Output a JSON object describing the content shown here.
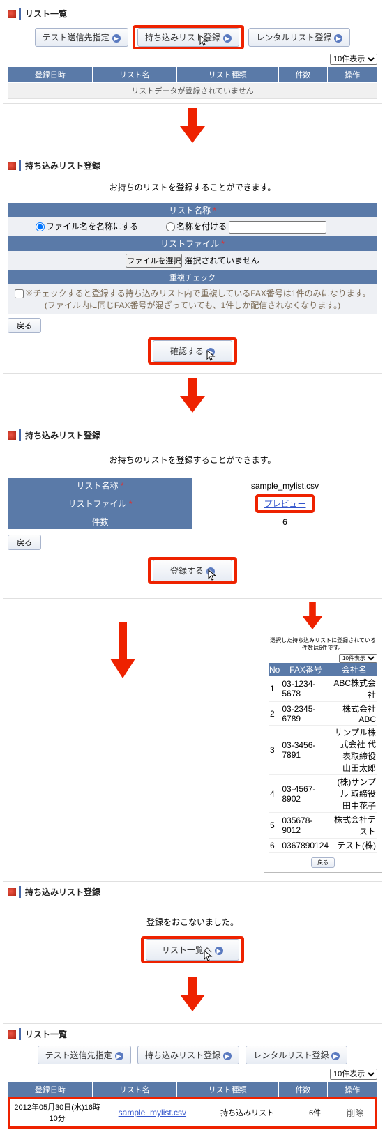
{
  "panel1": {
    "title": "リスト一覧",
    "buttons": {
      "test": "テスト送信先指定",
      "import": "持ち込みリスト登録",
      "rental": "レンタルリスト登録"
    },
    "pager": "10件表示",
    "headers": {
      "date": "登録日時",
      "name": "リスト名",
      "type": "リスト種類",
      "count": "件数",
      "op": "操作"
    },
    "empty": "リストデータが登録されていません"
  },
  "panel2": {
    "title": "持ち込みリスト登録",
    "lead": "お持ちのリストを登録することができます。",
    "sec_name": "リスト名称",
    "opt_filename": "ファイル名を名称にする",
    "opt_custom": "名称を付ける",
    "sec_file": "リストファイル",
    "file_btn": "ファイルを選択",
    "file_none": "選択されていません",
    "sec_dup": "重複チェック",
    "dup_note1": "※チェックすると登録する持ち込みリスト内で重複しているFAX番号は1件のみになります。",
    "dup_note2": "(ファイル内に同じFAX番号が混ざっていても、1件しか配信されなくなります。)",
    "back": "戻る",
    "confirm": "確認する"
  },
  "panel3": {
    "title": "持ち込みリスト登録",
    "lead": "お持ちのリストを登録することができます。",
    "row_name": "リスト名称",
    "row_name_val": "sample_mylist.csv",
    "row_file": "リストファイル",
    "row_file_val": "プレビュー",
    "row_count": "件数",
    "row_count_val": "6",
    "back": "戻る",
    "submit": "登録する"
  },
  "preview": {
    "caption": "選択した持ち込みリストに登録されている件数は6件です。",
    "pager": "10件表示",
    "h_no": "No",
    "h_fax": "FAX番号",
    "h_company": "会社名",
    "rows": [
      {
        "no": "1",
        "fax": "03-1234-5678",
        "co": "ABC株式会社"
      },
      {
        "no": "2",
        "fax": "03-2345-6789",
        "co": "株式会社ABC"
      },
      {
        "no": "3",
        "fax": "03-3456-7891",
        "co": "サンプル株式会社 代表取締役 山田太郎"
      },
      {
        "no": "4",
        "fax": "03-4567-8902",
        "co": "(株)サンプル 取締役 田中花子"
      },
      {
        "no": "5",
        "fax": "035678-9012",
        "co": "株式会社テスト"
      },
      {
        "no": "6",
        "fax": "0367890124",
        "co": "テスト(株)"
      }
    ],
    "back": "戻る"
  },
  "panel4": {
    "title": "持ち込みリスト登録",
    "msg": "登録をおこないました。",
    "tolist": "リスト一覧へ"
  },
  "panel5": {
    "title": "リスト一覧",
    "buttons": {
      "test": "テスト送信先指定",
      "import": "持ち込みリスト登録",
      "rental": "レンタルリスト登録"
    },
    "pager": "10件表示",
    "headers": {
      "date": "登録日時",
      "name": "リスト名",
      "type": "リスト種類",
      "count": "件数",
      "op": "操作"
    },
    "row": {
      "date": "2012年05月30日(水)16時10分",
      "name": "sample_mylist.csv",
      "type": "持ち込みリスト",
      "count": "6件",
      "op": "削除"
    }
  }
}
